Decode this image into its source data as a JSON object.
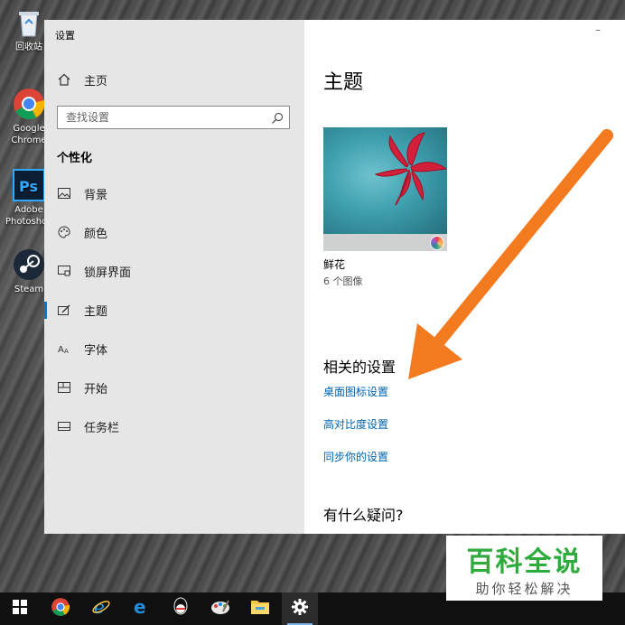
{
  "desktop": {
    "icons": [
      {
        "label": "回收站",
        "icon": "recycle-bin-icon"
      },
      {
        "label": "Google Chrome",
        "icon": "chrome-icon"
      },
      {
        "label": "Adobe Photoshop",
        "icon": "photoshop-icon"
      },
      {
        "label": "Steam",
        "icon": "steam-icon"
      }
    ]
  },
  "window": {
    "title": "设置",
    "minimize_symbol": "–"
  },
  "sidebar": {
    "home_label": "主页",
    "search_placeholder": "查找设置",
    "section_title": "个性化",
    "items": [
      {
        "label": "背景",
        "icon": "picture-icon"
      },
      {
        "label": "颜色",
        "icon": "palette-icon"
      },
      {
        "label": "锁屏界面",
        "icon": "lock-screen-icon"
      },
      {
        "label": "主题",
        "icon": "theme-icon",
        "active": true
      },
      {
        "label": "字体",
        "icon": "font-icon"
      },
      {
        "label": "开始",
        "icon": "start-icon"
      },
      {
        "label": "任务栏",
        "icon": "taskbar-icon"
      }
    ]
  },
  "main": {
    "title": "主题",
    "theme": {
      "name": "鲜花",
      "count": "6 个图像"
    },
    "related_title": "相关的设置",
    "links": [
      "桌面图标设置",
      "高对比度设置",
      "同步你的设置"
    ],
    "help_title": "有什么疑问?"
  },
  "taskbar": {
    "items": [
      "windows-start-icon",
      "chrome-icon",
      "ie-icon",
      "edge-icon",
      "qq-icon",
      "paint-icon",
      "file-explorer-icon",
      "settings-gear-icon"
    ]
  },
  "watermark": {
    "title": "百科全说",
    "subtitle": "助你轻松解决"
  },
  "colors": {
    "accent": "#0078d7",
    "link": "#0063b1",
    "arrow": "#f47a20",
    "watermark_green": "#2dab3d"
  }
}
